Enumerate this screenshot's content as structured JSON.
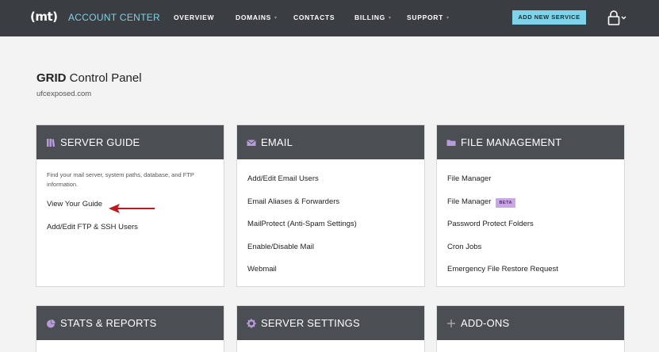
{
  "header": {
    "logo": "(mt)",
    "brand": "ACCOUNT CENTER",
    "nav": [
      {
        "label": "OVERVIEW",
        "dropdown": false
      },
      {
        "label": "DOMAINS",
        "dropdown": true
      },
      {
        "label": "CONTACTS",
        "dropdown": false
      },
      {
        "label": "BILLING",
        "dropdown": true
      },
      {
        "label": "SUPPORT",
        "dropdown": true
      }
    ],
    "add_service": "ADD NEW SERVICE",
    "caret": "▾"
  },
  "page": {
    "title_bold": "GRID",
    "title_rest": " Control Panel",
    "subtitle": "ufcexposed.com"
  },
  "cards": {
    "server_guide": {
      "title": "SERVER GUIDE",
      "icon": "book-icon",
      "description": "Find your mail server, system paths, database, and FTP information.",
      "links": [
        "View Your Guide",
        "Add/Edit FTP & SSH Users"
      ]
    },
    "email": {
      "title": "EMAIL",
      "icon": "envelope-icon",
      "links": [
        "Add/Edit Email Users",
        "Email Aliases & Forwarders",
        "MailProtect (Anti-Spam Settings)",
        "Enable/Disable Mail",
        "Webmail"
      ]
    },
    "file_management": {
      "title": "FILE MANAGEMENT",
      "icon": "folder-icon",
      "links": [
        "File Manager",
        "File Manager",
        "Password Protect Folders",
        "Cron Jobs",
        "Emergency File Restore Request"
      ],
      "beta_badge": "BETA"
    },
    "stats_reports": {
      "title": "STATS & REPORTS",
      "icon": "pie-chart-icon"
    },
    "server_settings": {
      "title": "SERVER SETTINGS",
      "icon": "gear-icon"
    },
    "add_ons": {
      "title": "ADD-ONS",
      "icon": "plus-icon"
    }
  },
  "colors": {
    "topbar": "#3a3d42",
    "accent": "#7fd3e8",
    "card_header": "#4b4e53",
    "icon_purple": "#b79cdb",
    "annotation_arrow": "#c0161c"
  }
}
